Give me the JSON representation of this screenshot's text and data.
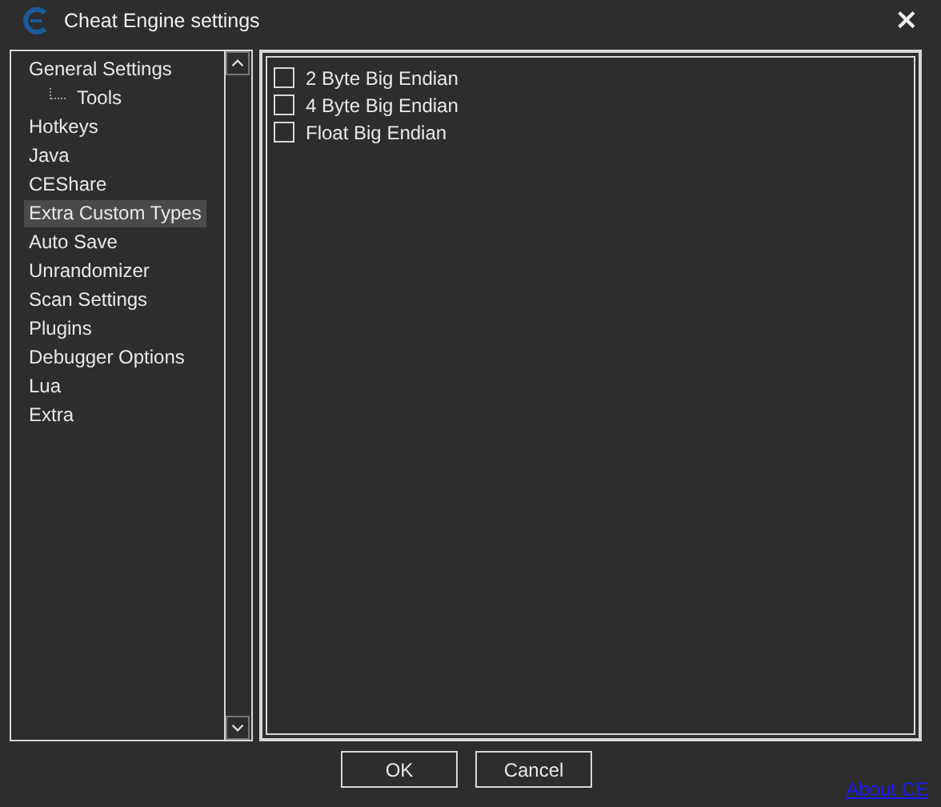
{
  "window": {
    "title": "Cheat Engine settings",
    "close": "×"
  },
  "sidebar": {
    "items": [
      {
        "label": "General Settings",
        "selected": false,
        "children": [
          {
            "label": "Tools",
            "selected": false
          }
        ]
      },
      {
        "label": "Hotkeys",
        "selected": false
      },
      {
        "label": "Java",
        "selected": false
      },
      {
        "label": "CEShare",
        "selected": false
      },
      {
        "label": "Extra Custom Types",
        "selected": true
      },
      {
        "label": "Auto Save",
        "selected": false
      },
      {
        "label": "Unrandomizer",
        "selected": false
      },
      {
        "label": "Scan Settings",
        "selected": false
      },
      {
        "label": "Plugins",
        "selected": false
      },
      {
        "label": "Debugger Options",
        "selected": false
      },
      {
        "label": "Lua",
        "selected": false
      },
      {
        "label": "Extra",
        "selected": false
      }
    ]
  },
  "options": [
    {
      "label": "2 Byte Big Endian",
      "checked": false
    },
    {
      "label": "4 Byte Big Endian",
      "checked": false
    },
    {
      "label": "Float Big Endian",
      "checked": false
    }
  ],
  "buttons": [
    "OK",
    "Cancel"
  ],
  "link": "About CE"
}
